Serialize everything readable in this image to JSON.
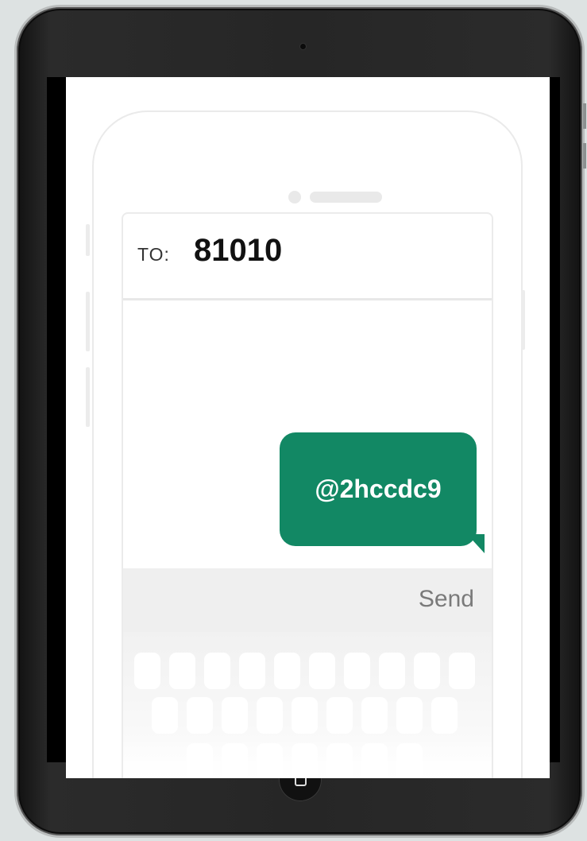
{
  "message": {
    "to_label": "TO:",
    "to_number": "81010",
    "bubble_text": "@2hccdc9",
    "send_label": "Send"
  },
  "colors": {
    "bubble": "#128864",
    "frame": "#262626"
  },
  "icons": [
    "camera-icon",
    "home-button-icon"
  ]
}
